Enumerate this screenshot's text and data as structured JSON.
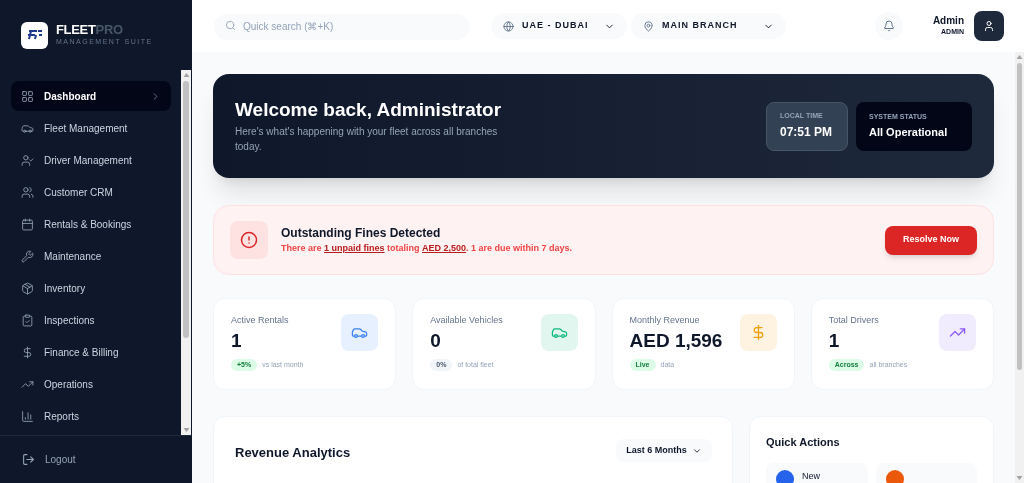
{
  "brand": {
    "name_primary": "FLEET",
    "name_accent": "PRO",
    "tagline": "MANAGEMENT SUITE"
  },
  "sidebar": {
    "items": [
      {
        "label": "Dashboard",
        "selected": true
      },
      {
        "label": "Fleet Management",
        "selected": false
      },
      {
        "label": "Driver Management",
        "selected": false
      },
      {
        "label": "Customer CRM",
        "selected": false
      },
      {
        "label": "Rentals & Bookings",
        "selected": false
      },
      {
        "label": "Maintenance",
        "selected": false
      },
      {
        "label": "Inventory",
        "selected": false
      },
      {
        "label": "Inspections",
        "selected": false
      },
      {
        "label": "Finance & Billing",
        "selected": false
      },
      {
        "label": "Operations",
        "selected": false
      },
      {
        "label": "Reports",
        "selected": false
      }
    ],
    "logout": "Logout"
  },
  "header": {
    "search": {
      "placeholder": "Quick search (⌘+K)"
    },
    "region": "UAE - DUBAI",
    "branch": "MAIN BRANCH",
    "user": {
      "name": "Admin",
      "role": "ADMIN"
    }
  },
  "welcome": {
    "title": "Welcome back, Administrator",
    "subtitle": "Here's what's happening with your fleet across all branches today.",
    "local_time": {
      "label": "LOCAL TIME",
      "value": "07:51 PM"
    },
    "system_status": {
      "label": "SYSTEM STATUS",
      "value": "All Operational"
    }
  },
  "alert": {
    "title": "Outstanding Fines Detected",
    "message": "There are **1 unpaid fines** totaling **AED 2,500**. 1 are due within 7 days.",
    "button": "Resolve Now"
  },
  "stats": [
    {
      "label": "Active Rentals",
      "value": "1",
      "badge": {
        "text": "+5%",
        "kind": "positive"
      },
      "note": "vs last month",
      "color": "#3b82f6"
    },
    {
      "label": "Available Vehicles",
      "value": "0",
      "badge": {
        "text": "0%",
        "kind": "neutral"
      },
      "note": "of total fleet",
      "color": "#10b981"
    },
    {
      "label": "Monthly Revenue",
      "value": "AED 1,596",
      "badge": {
        "text": "Live",
        "kind": "positive"
      },
      "note": "data",
      "color": "#f59e0b"
    },
    {
      "label": "Total Drivers",
      "value": "1",
      "badge": {
        "text": "Across",
        "kind": "positive"
      },
      "note": "all branches",
      "color": "#8b5cf6"
    }
  ],
  "revenue": {
    "title": "Revenue Analytics",
    "period": "Last 6 Months"
  },
  "quick_actions": {
    "title": "Quick Actions",
    "items": [
      {
        "label": "New",
        "color": "#2563eb"
      },
      {
        "color": "#ea580c"
      }
    ]
  }
}
